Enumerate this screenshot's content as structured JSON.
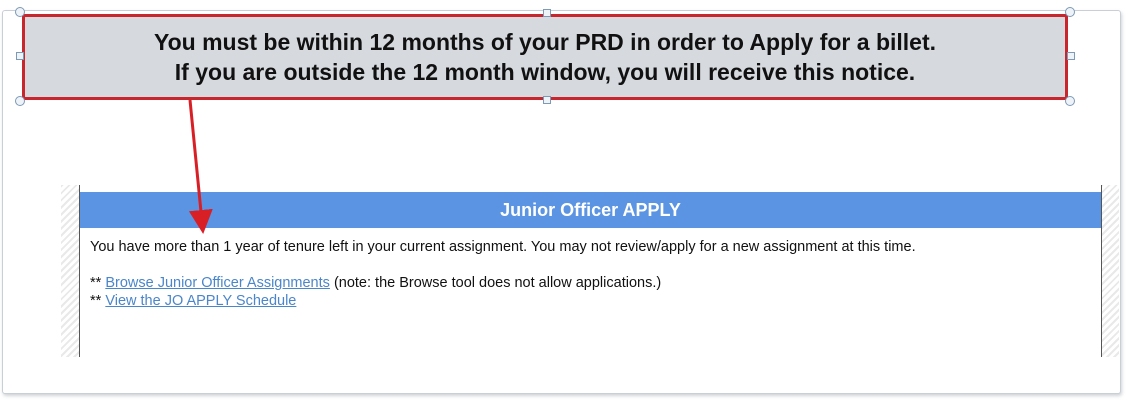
{
  "callout": {
    "line1": "You must be within 12 months of your PRD in order to Apply for a billet.",
    "line2": "If you are outside the 12 month window, you will receive this notice."
  },
  "panel": {
    "header": "Junior Officer APPLY",
    "message": "You have more than 1 year of tenure left in your current assignment. You may not review/apply for a new assignment at this time.",
    "links": [
      {
        "prefix": "**",
        "text": "Browse Junior Officer Assignments",
        "note": "(note: the Browse tool does not allow applications.)"
      },
      {
        "prefix": "**",
        "text": "View the JO APPLY Schedule",
        "note": ""
      }
    ]
  },
  "colors": {
    "callout_border": "#c8262c",
    "callout_fill": "#d6dadf",
    "header_bar": "#5b94e3",
    "link": "#4a86c9",
    "arrow": "#d81f26"
  }
}
